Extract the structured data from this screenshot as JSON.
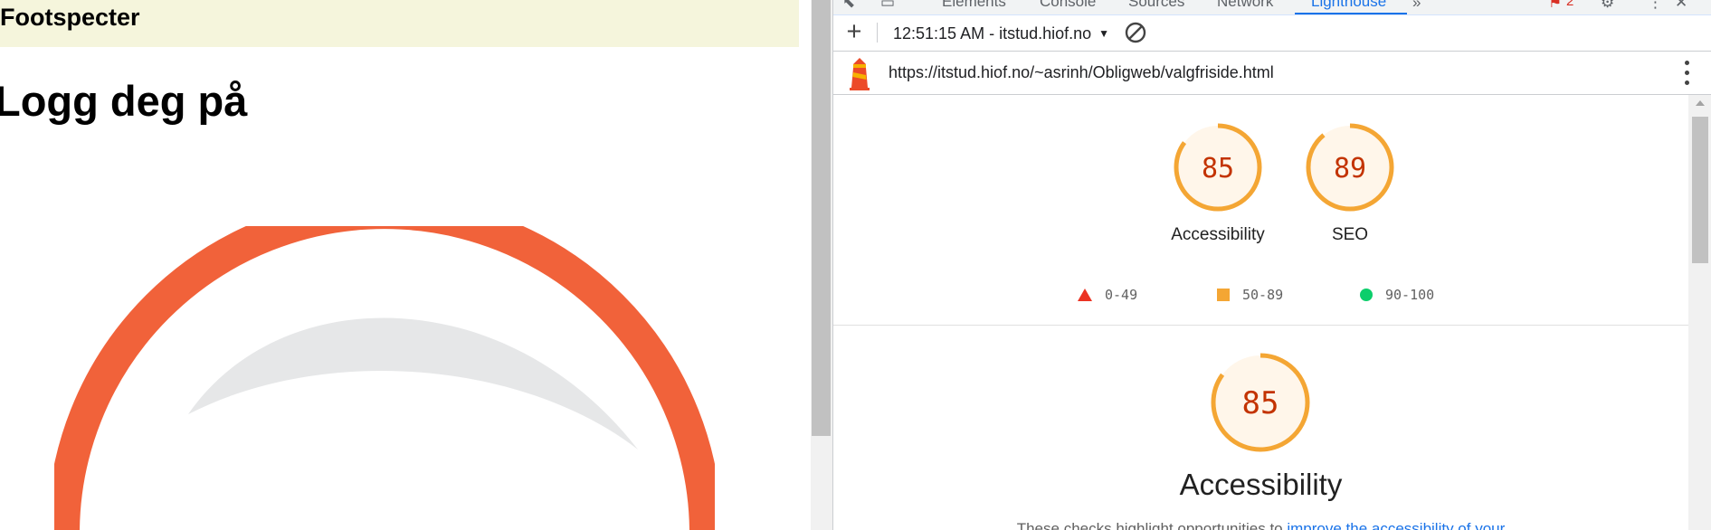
{
  "page": {
    "site_name": "Footspecter",
    "login_heading": "Logg deg på"
  },
  "devtools": {
    "tabs": [
      {
        "label": "Elements",
        "active": false
      },
      {
        "label": "Console",
        "active": false
      },
      {
        "label": "Sources",
        "active": false
      },
      {
        "label": "Network",
        "active": false
      },
      {
        "label": "Lighthouse",
        "active": true
      }
    ],
    "overflow_label": "»",
    "issues_count": "2",
    "toolbar": {
      "new_report_label": "+",
      "report_selector": "12:51:15 AM - itstud.hiof.no"
    },
    "url": "https://itstud.hiof.no/~asrinh/Obligweb/valgfriside.html",
    "gauges": [
      {
        "label": "Accessibility",
        "score": "85"
      },
      {
        "label": "SEO",
        "score": "89"
      }
    ],
    "legend": [
      {
        "range": "0-49",
        "color": "#eb3323"
      },
      {
        "range": "50-89",
        "color": "#f4a634"
      },
      {
        "range": "90-100",
        "color": "#0cce6b"
      }
    ],
    "section": {
      "score": "85",
      "title": "Accessibility",
      "description_prefix": "These checks highlight opportunities to ",
      "description_link": "improve the accessibility of your"
    }
  },
  "colors": {
    "gauge_orange": "#f4a634",
    "gauge_text": "#c33300",
    "gauge_fill": "#fff6ea",
    "header_bg": "#f5f5dc",
    "logo_ring": "#f1623a",
    "accent": "#1a73e8"
  }
}
